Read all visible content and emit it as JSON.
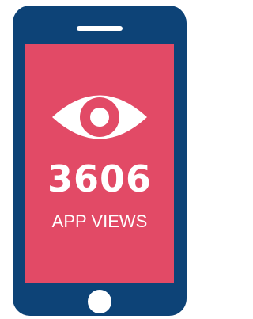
{
  "phone": {
    "icon": "eye-icon",
    "count": "3606",
    "label": "APP VIEWS",
    "colors": {
      "body": "#0d4377",
      "screen": "#e24a66",
      "foreground": "#ffffff"
    }
  }
}
